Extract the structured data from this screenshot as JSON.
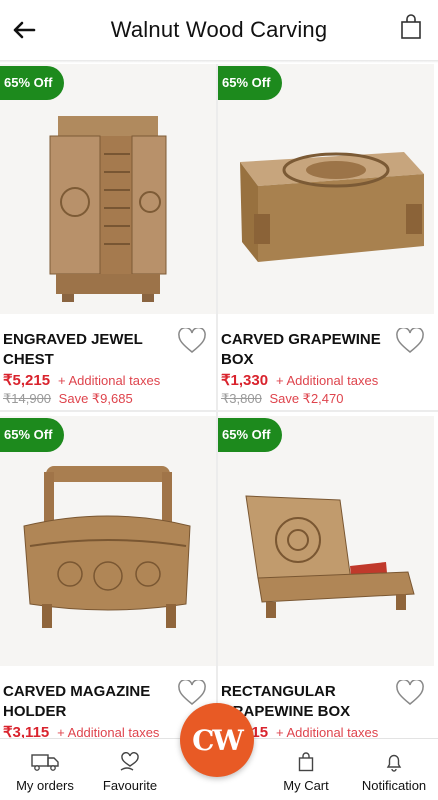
{
  "header": {
    "title": "Walnut Wood Carving",
    "back_icon": "back-arrow-icon",
    "cart_icon": "shopping-bag-icon"
  },
  "products": [
    {
      "badge": "65% Off",
      "name_line1": "ENGRAVED JEWEL",
      "name_line2": "CHEST",
      "price": "₹5,215",
      "taxes": "+ Additional taxes",
      "mrp": "₹14,900",
      "save": "Save ₹9,685"
    },
    {
      "badge": "65% Off",
      "name_line1": "CARVED GRAPEWINE",
      "name_line2": "BOX",
      "price": "₹1,330",
      "taxes": "+ Additional taxes",
      "mrp": "₹3,800",
      "save": "Save ₹2,470"
    },
    {
      "badge": "65% Off",
      "name_line1": "CARVED MAGAZINE",
      "name_line2": "HOLDER",
      "price": "₹3,115",
      "taxes": "+ Additional taxes",
      "mrp": "",
      "save": ""
    },
    {
      "badge": "65% Off",
      "name_line1": "RECTANGULAR",
      "name_line2": "GRAPEWINE BOX",
      "price": "₹1,715",
      "taxes": "+ Additional taxes",
      "mrp": "",
      "save": ""
    }
  ],
  "bottom_nav": {
    "orders": "My orders",
    "favourite": "Favourite",
    "logo": "CW",
    "cart": "My Cart",
    "notification": "Notification"
  },
  "colors": {
    "accent_green": "#1d8a1d",
    "price_red": "#d9232d",
    "logo_orange": "#e85a25"
  }
}
